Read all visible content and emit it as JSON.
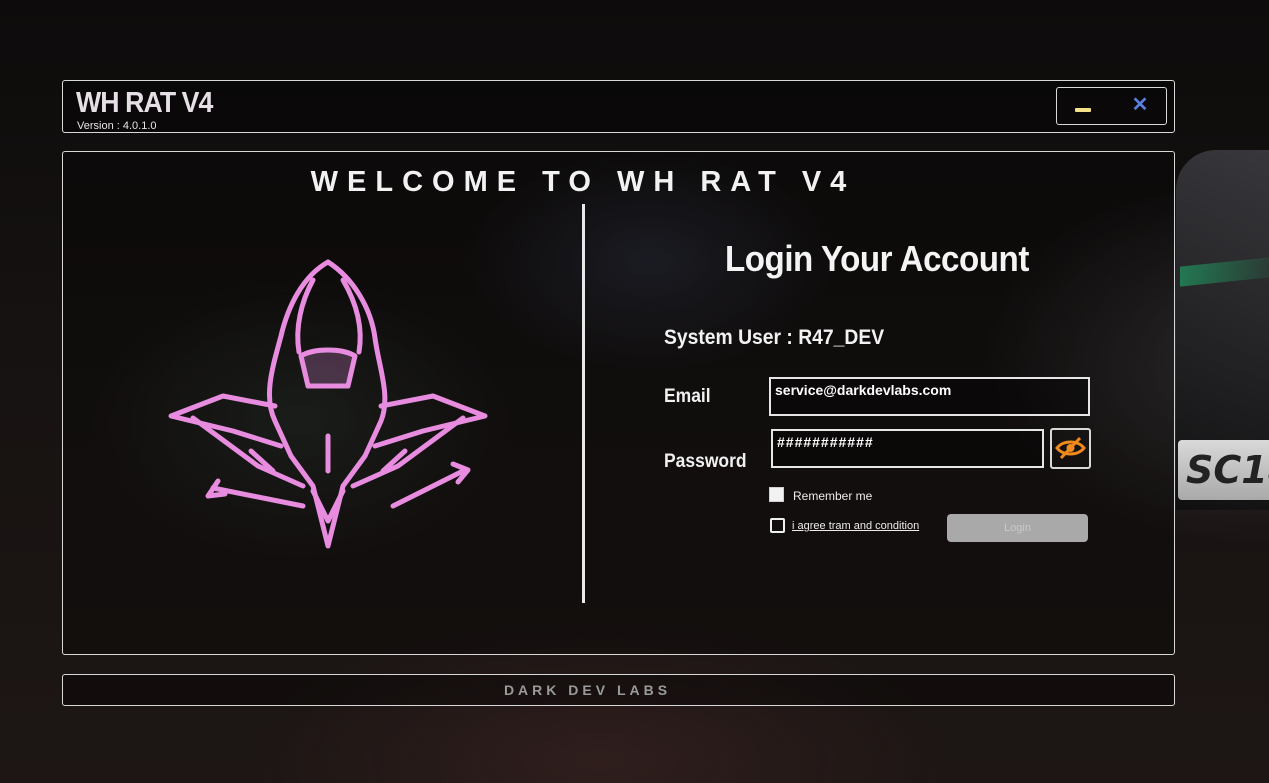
{
  "window": {
    "title": "WH RAT V4",
    "version": "Version : 4.0.1.0",
    "minimize_icon": "minimize-icon",
    "close_icon": "close-icon",
    "accent_minimize": "#f4e28a",
    "accent_close": "#5a7fe0"
  },
  "main": {
    "welcome": "WELCOME TO WH RAT V4",
    "logo_icon": "hooded-assassin-logo",
    "logo_color": "#e88ce0"
  },
  "login": {
    "title": "Login Your Account",
    "system_user": "System User : R47_DEV",
    "email_label": "Email",
    "email_value": "service@darkdevlabs.com",
    "password_label": "Password",
    "password_value": "###########",
    "show_password_icon": "eye-slash-icon",
    "remember_label": "Remember me",
    "agree_label": "i agree tram and condition",
    "login_button": "Login"
  },
  "footer": {
    "text": "DARK DEV LABS"
  }
}
